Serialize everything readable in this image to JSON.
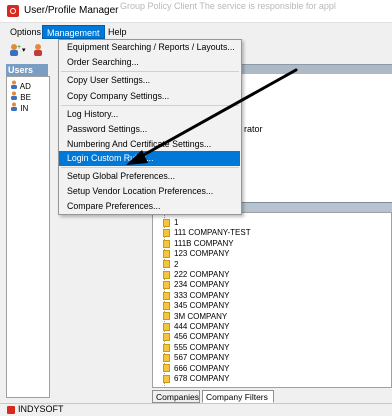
{
  "window": {
    "title": "User/Profile Manager",
    "behind_text": "Group Policy Client          The service is responsible for appl"
  },
  "menubar": [
    "Options",
    "Management",
    "Help"
  ],
  "toolbar": {
    "caret": "▾"
  },
  "users": {
    "header": "Users",
    "items": [
      "AD",
      "BE",
      "IN"
    ]
  },
  "right_panel": {
    "fragment": "rator"
  },
  "management_menu": {
    "items": [
      "Equipment Searching / Reports / Layouts...",
      "Order Searching...",
      "Copy User Settings...",
      "Copy Company Settings...",
      "Log History...",
      "Password Settings...",
      "Numbering And Certificate Settings...",
      "Login Custom Rules...",
      "Setup Global Preferences...",
      "Setup Vendor Location Preferences...",
      "Compare Preferences..."
    ],
    "highlighted_index": 7
  },
  "companies": [
    "1",
    "111 COMPANY-TEST",
    "111B COMPANY",
    "123 COMPANY",
    "2",
    "222 COMPANY",
    "234 COMPANY",
    "333 COMPANY",
    "345 COMPANY",
    "3M COMPANY",
    "444 COMPANY",
    "456 COMPANY",
    "555 COMPANY",
    "567 COMPANY",
    "666 COMPANY",
    "678 COMPANY"
  ],
  "tabs": [
    "Companies",
    "Company Filters"
  ],
  "active_tab": "Company Filters",
  "status_bar": {
    "text": "INDYSOFT"
  },
  "colors": {
    "highlight": "#0078d7",
    "users_header": "#7a9dc3",
    "folder": "#f5c542",
    "app_icon": "#d9281d"
  }
}
